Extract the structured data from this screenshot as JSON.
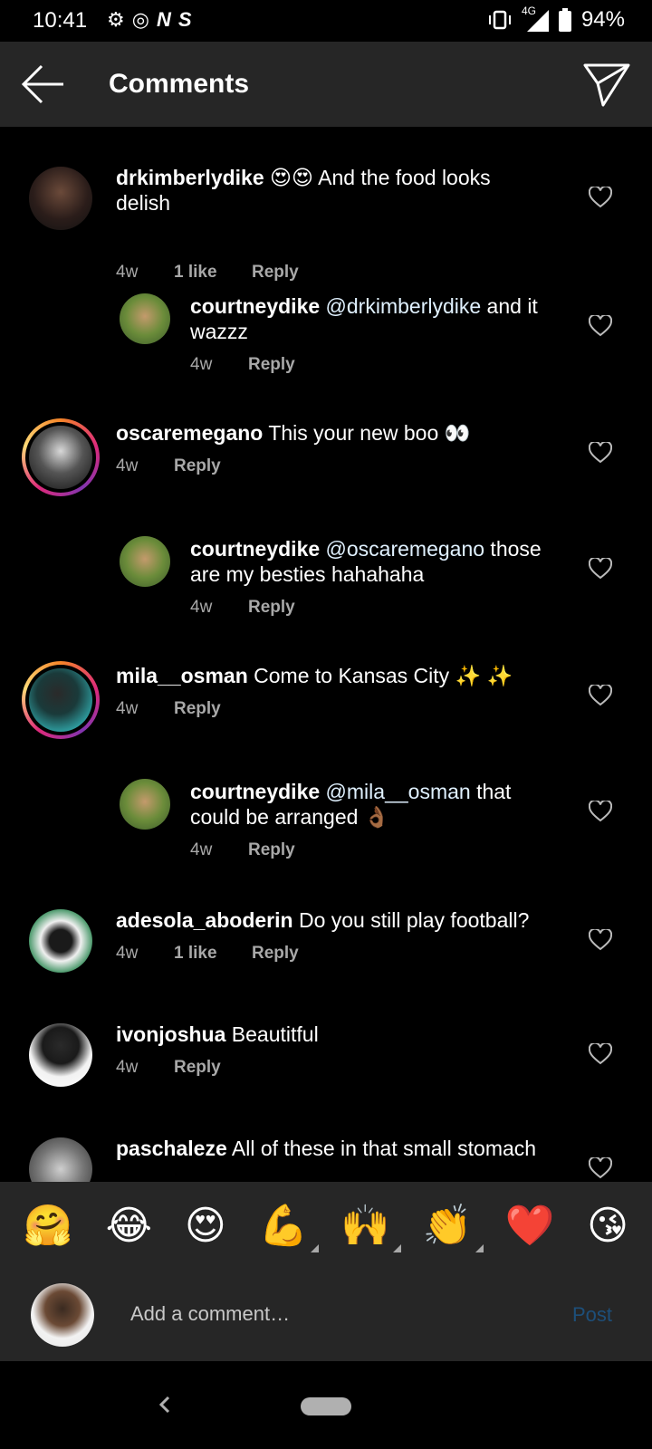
{
  "status_bar": {
    "time": "10:41",
    "network": "4G",
    "battery": "94%"
  },
  "header": {
    "title": "Comments"
  },
  "comments": [
    {
      "user": "drkimberlydike",
      "text": " 😍😍 And the food looks delish",
      "time": "4w",
      "likes": "1 like",
      "reply": "Reply"
    },
    {
      "user": "courtneydike",
      "mention": " @drkimberlydike",
      "text": " and it wazzz",
      "time": "4w",
      "reply": "Reply"
    },
    {
      "user": "oscaremegano",
      "text": " This your new boo 👀",
      "time": "4w",
      "reply": "Reply"
    },
    {
      "user": "courtneydike",
      "mention": " @oscaremegano",
      "text": " those are my besties hahahaha",
      "time": "4w",
      "reply": "Reply"
    },
    {
      "user": "mila__osman",
      "text": " Come to Kansas City ✨ ✨",
      "time": "4w",
      "reply": "Reply"
    },
    {
      "user": "courtneydike",
      "mention": " @mila__osman",
      "text": " that could be arranged 👌🏾",
      "time": "4w",
      "reply": "Reply"
    },
    {
      "user": "adesola_aboderin",
      "text": " Do you still play football?",
      "time": "4w",
      "likes": "1 like",
      "reply": "Reply"
    },
    {
      "user": "ivonjoshua",
      "text": " Beautitful",
      "time": "4w",
      "reply": "Reply"
    },
    {
      "user": "paschaleze",
      "text": " All of these in that small stomach"
    }
  ],
  "emoji_bar": [
    "🤗",
    "😂",
    "😍",
    "💪",
    "🙌",
    "👏",
    "❤️",
    "😘"
  ],
  "composer": {
    "placeholder": "Add a comment…",
    "post_label": "Post"
  },
  "colors": {
    "background": "#000000",
    "header": "#262626",
    "meta_text": "#a8a8a8",
    "post_disabled": "#1d4f7a"
  }
}
